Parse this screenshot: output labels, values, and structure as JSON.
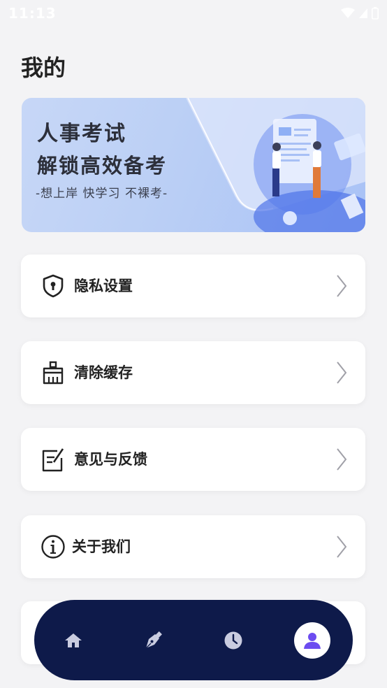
{
  "status_bar": {
    "time": "11:13",
    "icons": [
      "wifi-icon",
      "signal-icon",
      "battery-icon"
    ]
  },
  "page": {
    "title": "我的"
  },
  "banner": {
    "title_line1": "人事考试",
    "title_line2": "解锁高效备考",
    "slogan": "-想上岸 快学习 不裸考-"
  },
  "menu": {
    "items": [
      {
        "label": "隐私设置",
        "icon": "shield-lock-icon"
      },
      {
        "label": "清除缓存",
        "icon": "broom-icon"
      },
      {
        "label": "意见与反馈",
        "icon": "feedback-edit-icon"
      },
      {
        "label": "关于我们",
        "icon": "info-icon"
      },
      {
        "label": "",
        "icon": ""
      }
    ]
  },
  "tab_bar": {
    "items": [
      {
        "name": "home",
        "icon": "home-icon",
        "active": false
      },
      {
        "name": "write",
        "icon": "pen-nib-icon",
        "active": false
      },
      {
        "name": "history",
        "icon": "clock-icon",
        "active": false
      },
      {
        "name": "profile",
        "icon": "user-icon",
        "active": true
      }
    ]
  },
  "colors": {
    "background": "#f3f3f5",
    "tab_bar": "#0e1a4a",
    "active_accent": "#6c4cf0",
    "inactive_tab_icon": "#c9cce0"
  }
}
